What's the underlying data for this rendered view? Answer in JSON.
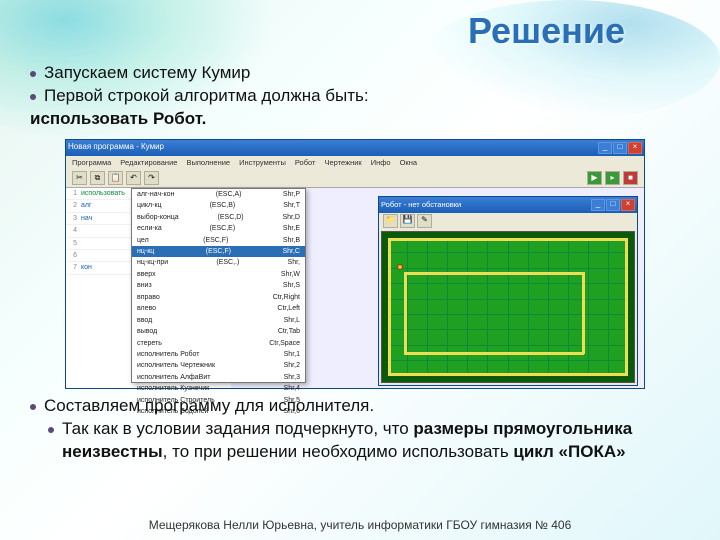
{
  "slide": {
    "title": "Решение",
    "bullets": {
      "b1": "Запускаем систему Кумир",
      "b2": "Первой строкой алгоритма должна быть:",
      "b2_bold": "использовать Робот.",
      "b3": "Составляем программу для исполнителя.",
      "b4a": "Так как в условии задания подчеркнуто, что ",
      "b4b": "размеры прямоугольника неизвестны",
      "b4c": ", то при решении необходимо использовать ",
      "b4d": "цикл «ПОКА»"
    },
    "footer": "Мещерякова Нелли Юрьевна, учитель информатики ГБОУ гимназия № 406"
  },
  "app": {
    "title": "Новая программа - Кумир",
    "menus": [
      "Программа",
      "Редактирование",
      "Выполнение",
      "Инструменты",
      "Робот",
      "Чертежник",
      "Инфо",
      "Окна"
    ],
    "robot_title": "Робот - нет обстановки"
  },
  "editor": {
    "lines": [
      {
        "n": "1",
        "t": "использовать",
        "cls": "kw-green"
      },
      {
        "n": "2",
        "t": "алг",
        "cls": "kw-blue"
      },
      {
        "n": "3",
        "t": "нач",
        "cls": "kw-blue"
      },
      {
        "n": "4",
        "t": "",
        "cls": ""
      },
      {
        "n": "5",
        "t": "",
        "cls": ""
      },
      {
        "n": "6",
        "t": "",
        "cls": ""
      },
      {
        "n": "7",
        "t": "кон",
        "cls": "kw-blue"
      }
    ]
  },
  "dropdown": {
    "items": [
      {
        "l": "алг-нач-кон",
        "r": "(ESC,A)",
        "sc": "Shr,P"
      },
      {
        "l": "цикл-кц",
        "r": "(ESC,B)",
        "sc": "Shr,T"
      },
      {
        "l": "выбор-конца",
        "r": "(ESC,D)",
        "sc": "Shr,D"
      },
      {
        "l": "если-ка",
        "r": "(ESC,E)",
        "sc": "Shr,E"
      },
      {
        "l": "цел",
        "r": "(ESC,F)",
        "sc": "Shr,B"
      },
      {
        "l": "нц-кц",
        "r": "(ESC,F)",
        "sc": "Shr,C",
        "hl": true
      },
      {
        "l": "нц-кц-при",
        "r": "(ESC,.)",
        "sc": "Shr,"
      },
      {
        "l": "вверх",
        "r": "",
        "sc": "Shr,W"
      },
      {
        "l": "вниз",
        "r": "",
        "sc": "Shr,S"
      },
      {
        "l": "вправо",
        "r": "",
        "sc": "Ctr,Right"
      },
      {
        "l": "влево",
        "r": "",
        "sc": "Ctr,Left"
      },
      {
        "l": "ввод",
        "r": "",
        "sc": "Shr,L"
      },
      {
        "l": "вывод",
        "r": "",
        "sc": "Ctr,Tab"
      },
      {
        "l": "стереть",
        "r": "",
        "sc": "Ctr,Space"
      },
      {
        "l": "исполнитель Робот",
        "r": "",
        "sc": "Shr,1"
      },
      {
        "l": "исполнитель Чертежник",
        "r": "",
        "sc": "Shr,2"
      },
      {
        "l": "исполнитель АлфаВит",
        "r": "",
        "sc": "Shr,3"
      },
      {
        "l": "исполнитель Кузнечик",
        "r": "",
        "sc": "Shr,4"
      },
      {
        "l": "исполнитель Строитель",
        "r": "",
        "sc": "Shr,5"
      },
      {
        "l": "исполнитель Водолей",
        "r": "",
        "sc": "Shr,6"
      }
    ]
  }
}
